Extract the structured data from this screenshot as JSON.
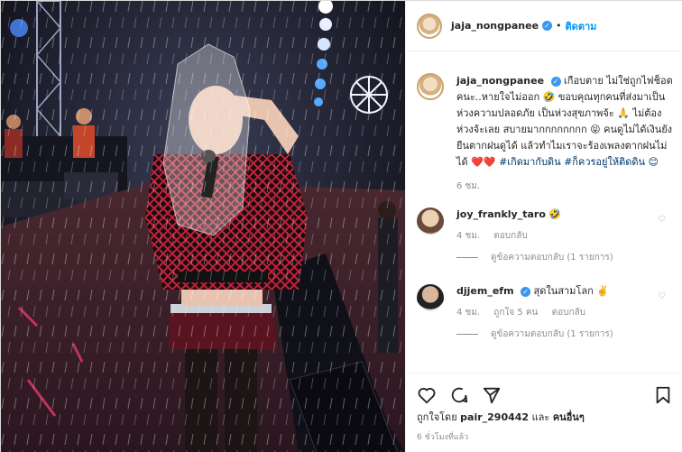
{
  "post": {
    "username": "jaja_nongpanee",
    "follow_label": "ติดตาม",
    "caption_text": "เกือบตาย ไม่ใช่ถูกไฟช็อตคนะ..หายใจไม่ออก 🤣 ขอบคุณทุกคนที่ส่งมาเป็นห่วงความปลอดภัย เป็นห่วงสุขภาพจ้ะ 🙏 ไม่ต้องห่วงจ้ะเลย สบายมากกกกกกกก 😝 คนดูไม่ได้เงินยังยืนตากฝนดูได้ แล้วทำไมเราจะร้องเพลงตากฝนไม่ได้ ❤️❤️",
    "hashtags": "#เกิดมากับดิน #ก็ควรอยู่ให้ติดดิน 😊",
    "timestamp": "6 ชม."
  },
  "comments": [
    {
      "username": "joy_frankly_taro",
      "text": "🤣",
      "age": "4 ชม.",
      "likes": "",
      "reply_label": "ตอบกลับ",
      "view_replies": "ดูข้อความตอบกลับ (1 รายการ)",
      "verified": false
    },
    {
      "username": "djjem_efm",
      "text": "สุดในสามโลก ✌️",
      "age": "4 ชม.",
      "likes": "ถูกใจ 5 คน",
      "reply_label": "ตอบกลับ",
      "view_replies": "ดูข้อความตอบกลับ (1 รายการ)",
      "verified": true
    }
  ],
  "footer": {
    "liked_by_prefix": "ถูกใจโดย",
    "liked_by_user": "pair_290442",
    "liked_by_and": "และ",
    "liked_by_others": "คนอื่นๆ",
    "time_ago": "6 ชั่วโมงที่แล้ว"
  },
  "colors": {
    "link_blue": "#0095f6",
    "verified": "#3897f0",
    "hashtag": "#00376b",
    "muted": "#8e8e8e",
    "heart_red": "#ed4956"
  },
  "icons": {
    "verified": "verified-badge-icon",
    "heart": "heart-icon",
    "comment": "comment-icon",
    "share": "share-icon",
    "bookmark": "bookmark-icon"
  }
}
